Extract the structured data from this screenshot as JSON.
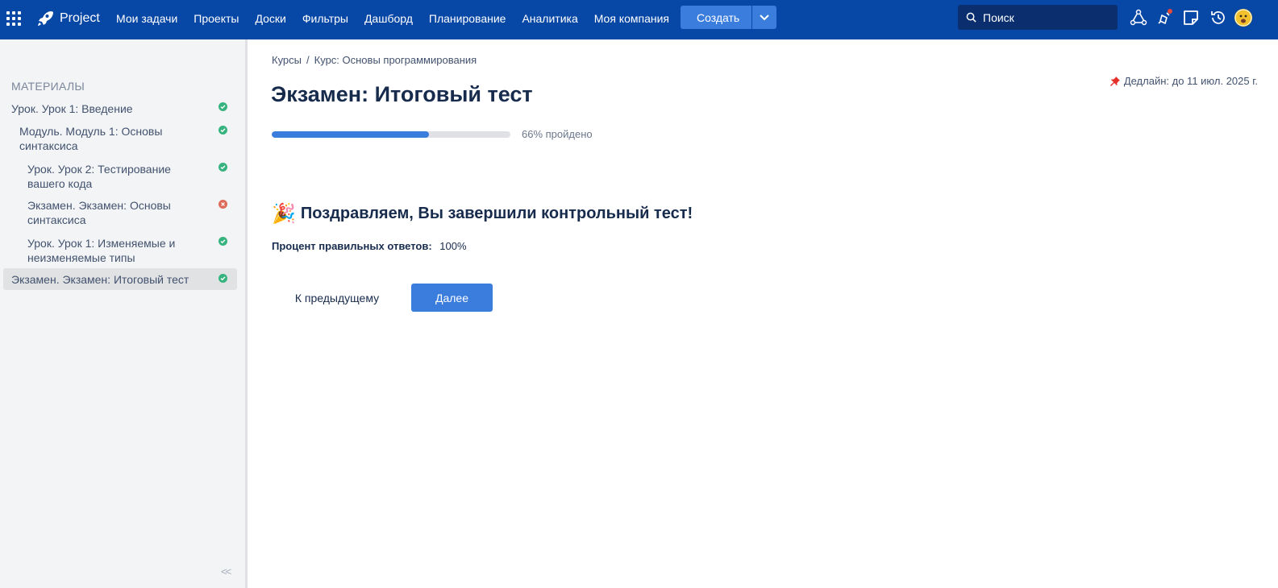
{
  "app": {
    "name": "Project"
  },
  "nav": {
    "items": [
      "Мои задачи",
      "Проекты",
      "Доски",
      "Фильтры",
      "Дашборд",
      "Планирование",
      "Аналитика",
      "Моя компания"
    ],
    "create_label": "Создать",
    "search_placeholder": "Поиск"
  },
  "sidebar": {
    "title": "МАТЕРИАЛЫ",
    "items": [
      {
        "label": "Урок. Урок 1: Введение",
        "status": "done"
      },
      {
        "label": "Модуль. Модуль 1: Основы синтаксиса",
        "status": "done"
      },
      {
        "label": "Урок. Урок 2: Тестирование вашего кода",
        "status": "done"
      },
      {
        "label": "Экзамен. Экзамен: Основы синтаксиса",
        "status": "failed"
      },
      {
        "label": "Урок. Урок 1: Изменяемые и неизменяемые типы",
        "status": "done"
      },
      {
        "label": "Экзамен. Экзамен: Итоговый тест",
        "status": "done",
        "active": true
      }
    ],
    "collapse_label": "<<"
  },
  "breadcrumb": {
    "items": [
      "Курсы",
      "Курс: Основы программирования"
    ],
    "separator": "/"
  },
  "deadline": "Дедлайн: до 11 июл. 2025 г.",
  "page": {
    "title": "Экзамен: Итоговый тест",
    "progress_fraction": 0.66,
    "progress_text": "66% пройдено",
    "congrats_emoji": "🎉",
    "congrats": "Поздравляем, Вы завершили контрольный тест!",
    "score_label": "Процент правильных ответов:",
    "score_value": "100%"
  },
  "buttons": {
    "prev": "К предыдущему",
    "next": "Далее"
  },
  "colors": {
    "topbar": "#0747a6",
    "accent": "#3b7ddd",
    "done": "#36b37e",
    "failed": "#de6b5a"
  }
}
